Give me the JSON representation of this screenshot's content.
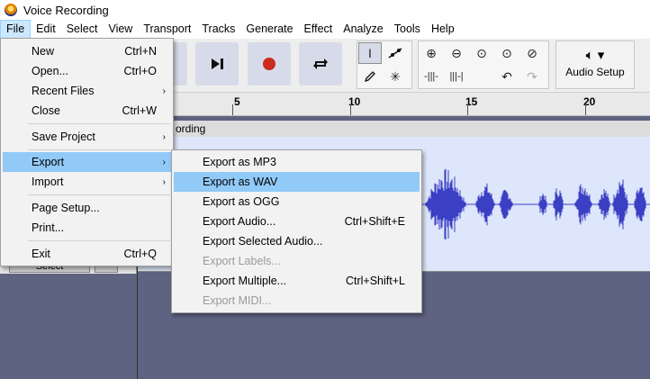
{
  "window": {
    "title": "Voice Recording"
  },
  "menubar": {
    "items": [
      {
        "label": "File",
        "active": true
      },
      {
        "label": "Edit"
      },
      {
        "label": "Select"
      },
      {
        "label": "View"
      },
      {
        "label": "Transport"
      },
      {
        "label": "Tracks"
      },
      {
        "label": "Generate"
      },
      {
        "label": "Effect"
      },
      {
        "label": "Analyze"
      },
      {
        "label": "Tools"
      },
      {
        "label": "Help"
      }
    ]
  },
  "toolbar": {
    "audio_setup_label": "Audio Setup",
    "record_color": "#cc2a1c"
  },
  "ruler": {
    "labels": [
      "5",
      "10",
      "15",
      "20"
    ]
  },
  "track": {
    "name_partial": "ording",
    "select_label": "Select",
    "wave_color": "#3a3fc4"
  },
  "file_menu": {
    "items": [
      {
        "label": "New",
        "shortcut": "Ctrl+N"
      },
      {
        "label": "Open...",
        "shortcut": "Ctrl+O"
      },
      {
        "label": "Recent Files",
        "submenu": true
      },
      {
        "label": "Close",
        "shortcut": "Ctrl+W"
      },
      {
        "label": "Save Project",
        "submenu": true
      },
      {
        "label": "Export",
        "submenu": true,
        "highlighted": true
      },
      {
        "label": "Import",
        "submenu": true
      },
      {
        "label": "Page Setup..."
      },
      {
        "label": "Print..."
      },
      {
        "label": "Exit",
        "shortcut": "Ctrl+Q"
      }
    ],
    "submenu_arrow": "›"
  },
  "export_menu": {
    "items": [
      {
        "label": "Export as MP3"
      },
      {
        "label": "Export as WAV",
        "highlighted": true
      },
      {
        "label": "Export as OGG"
      },
      {
        "label": "Export Audio...",
        "shortcut": "Ctrl+Shift+E"
      },
      {
        "label": "Export Selected Audio..."
      },
      {
        "label": "Export Labels...",
        "disabled": true
      },
      {
        "label": "Export Multiple...",
        "shortcut": "Ctrl+Shift+L"
      },
      {
        "label": "Export MIDI...",
        "disabled": true
      }
    ]
  }
}
